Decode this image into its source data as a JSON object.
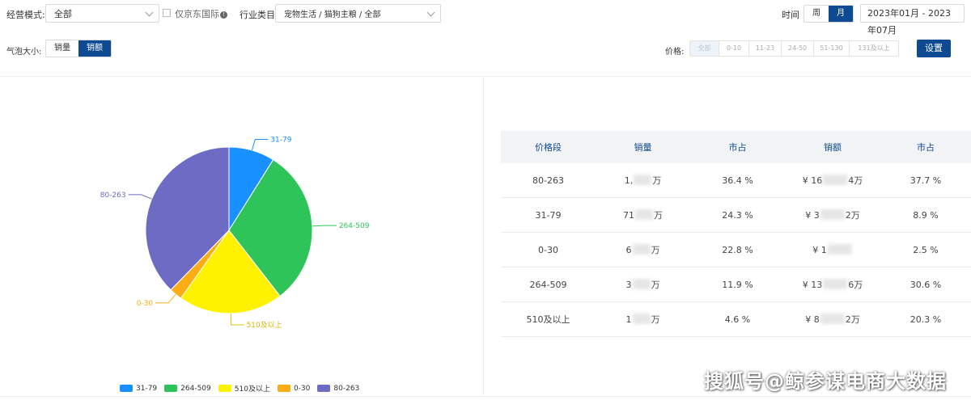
{
  "filters": {
    "mode_label": "经营模式:",
    "mode_value": "全部",
    "jd_intl_label": "仅京东国际",
    "industry_label": "行业类目",
    "industry_value": "宠物生活 / 猫狗主粮 / 全部",
    "time_label": "时间",
    "period_options": [
      {
        "label": "周",
        "active": false
      },
      {
        "label": "月",
        "active": true
      }
    ],
    "date_range": "2023年01月 - 2023年07月",
    "bubble_label": "气泡大小:",
    "bubble_options": [
      {
        "label": "销量",
        "active": false
      },
      {
        "label": "销额",
        "active": true
      }
    ],
    "price_label": "价格:",
    "price_options": [
      {
        "label": "全部",
        "active": true
      },
      {
        "label": "0-10",
        "active": false
      },
      {
        "label": "11-23",
        "active": false
      },
      {
        "label": "24-50",
        "active": false
      },
      {
        "label": "51-130",
        "active": false
      },
      {
        "label": "131及以上",
        "active": false
      }
    ],
    "settings_label": "设置"
  },
  "chart_data": {
    "type": "pie",
    "title": "",
    "slices": [
      {
        "name": "31-79",
        "value": 8.9,
        "color": "#1890ff"
      },
      {
        "name": "264-509",
        "value": 30.6,
        "color": "#2ec45a"
      },
      {
        "name": "510及以上",
        "value": 20.3,
        "color": "#fff200"
      },
      {
        "name": "0-30",
        "value": 2.5,
        "color": "#faad14"
      },
      {
        "name": "80-263",
        "value": 37.7,
        "color": "#6e6bc4"
      }
    ],
    "legend_position": "bottom",
    "legend": [
      "31-79",
      "264-509",
      "510及以上",
      "0-30",
      "80-263"
    ]
  },
  "table": {
    "headers": [
      "价格段",
      "销量",
      "市占",
      "销额",
      "市占"
    ],
    "rows": [
      {
        "seg": "80-263",
        "vol_pre": "1,",
        "vol_suf": "万",
        "share1": "36.4 %",
        "amt_pre": "¥ 16",
        "amt_suf": "4万",
        "share2": "37.7 %"
      },
      {
        "seg": "31-79",
        "vol_pre": "71",
        "vol_suf": "万",
        "share1": "24.3 %",
        "amt_pre": "¥ 3",
        "amt_suf": "2万",
        "share2": "8.9 %"
      },
      {
        "seg": "0-30",
        "vol_pre": "6",
        "vol_suf": "万",
        "share1": "22.8 %",
        "amt_pre": "¥ 1",
        "amt_suf": "",
        "share2": "2.5 %"
      },
      {
        "seg": "264-509",
        "vol_pre": "3",
        "vol_suf": "万",
        "share1": "11.9 %",
        "amt_pre": "¥ 13",
        "amt_suf": "6万",
        "share2": "30.6 %"
      },
      {
        "seg": "510及以上",
        "vol_pre": "1",
        "vol_suf": "万",
        "share1": "4.6 %",
        "amt_pre": "¥ 8",
        "amt_suf": "2万",
        "share2": "20.3 %"
      }
    ]
  },
  "watermark": "搜狐号@鲸参谋电商大数据"
}
